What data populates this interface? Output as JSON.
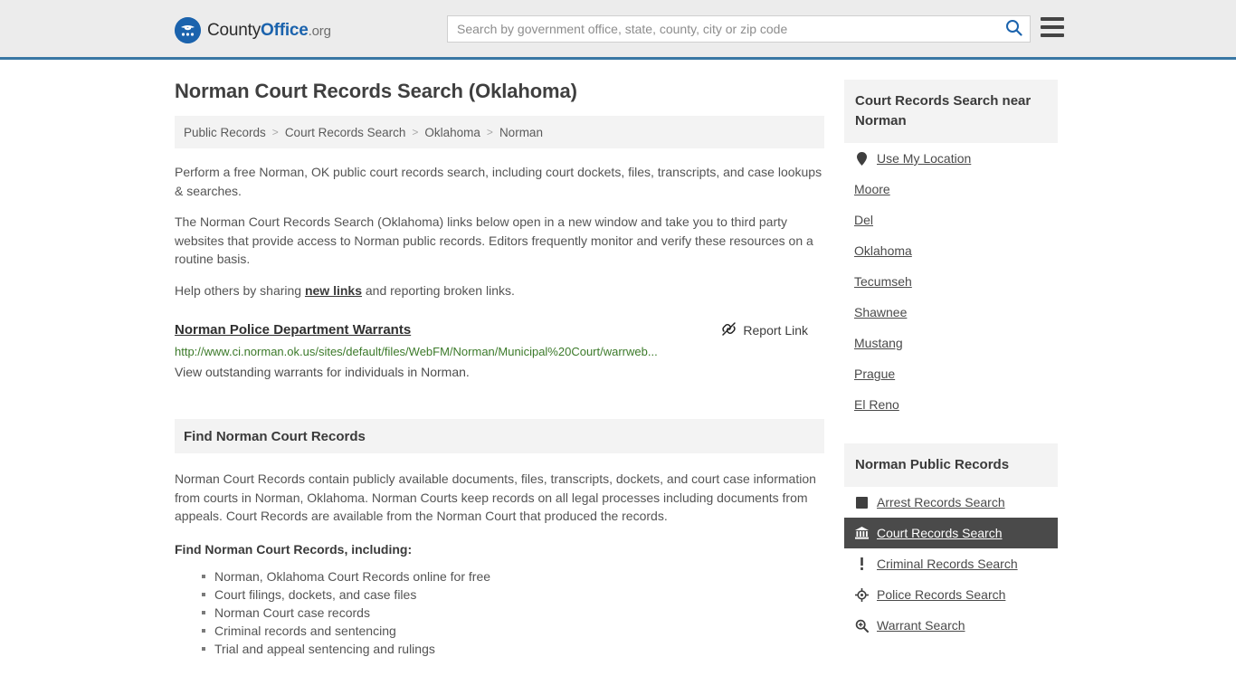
{
  "header": {
    "logo": {
      "icon": "eagle-seal-icon",
      "text_part1": "County",
      "text_part2": "Office",
      "text_part3": ".org"
    },
    "search": {
      "placeholder": "Search by government office, state, county, city or zip code",
      "value": "",
      "search_icon": "search-icon"
    },
    "menu_icon": "hamburger-menu-icon",
    "accent_color": "#3a77a4",
    "background_color": "#ececec"
  },
  "page": {
    "title": "Norman Court Records Search (Oklahoma)"
  },
  "breadcrumb": {
    "items": [
      {
        "label": "Public Records"
      },
      {
        "label": "Court Records Search"
      },
      {
        "label": "Oklahoma"
      },
      {
        "label": "Norman"
      }
    ],
    "separator": ">"
  },
  "intro": {
    "paragraph1": "Perform a free Norman, OK public court records search, including court dockets, files, transcripts, and case lookups & searches.",
    "paragraph2": "The Norman Court Records Search (Oklahoma) links below open in a new window and take you to third party websites that provide access to Norman public records. Editors frequently monitor and verify these resources on a routine basis.",
    "paragraph3_before": "Help others by sharing ",
    "paragraph3_link": "new links",
    "paragraph3_after": " and reporting broken links."
  },
  "result": {
    "title": "Norman Police Department Warrants",
    "url": "http://www.ci.norman.ok.us/sites/default/files/WebFM/Norman/Municipal%20Court/warrweb...",
    "description": "View outstanding warrants for individuals in Norman.",
    "report_label": "Report Link",
    "report_icon": "broken-link-icon",
    "url_color": "#3c7a2a"
  },
  "section": {
    "heading": "Find Norman Court Records",
    "paragraph": "Norman Court Records contain publicly available documents, files, transcripts, dockets, and court case information from courts in Norman, Oklahoma. Norman Courts keep records on all legal processes including documents from appeals. Court Records are available from the Norman Court that produced the records.",
    "list_intro": "Find Norman Court Records, including:",
    "bullets": [
      "Norman, Oklahoma Court Records online for free",
      "Court filings, dockets, and case files",
      "Norman Court case records",
      "Criminal records and sentencing",
      "Trial and appeal sentencing and rulings"
    ]
  },
  "sidebar": {
    "nearby": {
      "heading": "Court Records Search near Norman",
      "use_my_location": {
        "label": "Use My Location",
        "icon": "map-pin-icon"
      },
      "cities": [
        {
          "label": "Moore"
        },
        {
          "label": "Del"
        },
        {
          "label": "Oklahoma"
        },
        {
          "label": "Tecumseh"
        },
        {
          "label": "Shawnee"
        },
        {
          "label": "Mustang"
        },
        {
          "label": "Prague"
        },
        {
          "label": "El Reno"
        }
      ]
    },
    "public_records": {
      "heading": "Norman Public Records",
      "items": [
        {
          "label": "Arrest Records Search",
          "icon": "fingerprint-square-icon",
          "active": false
        },
        {
          "label": "Court Records Search",
          "icon": "courthouse-icon",
          "active": true
        },
        {
          "label": "Criminal Records Search",
          "icon": "exclamation-icon",
          "active": false
        },
        {
          "label": "Police Records Search",
          "icon": "police-badge-icon",
          "active": false
        },
        {
          "label": "Warrant Search",
          "icon": "magnifier-plus-icon",
          "active": false
        }
      ],
      "active_background": "#4a4a4a"
    }
  }
}
